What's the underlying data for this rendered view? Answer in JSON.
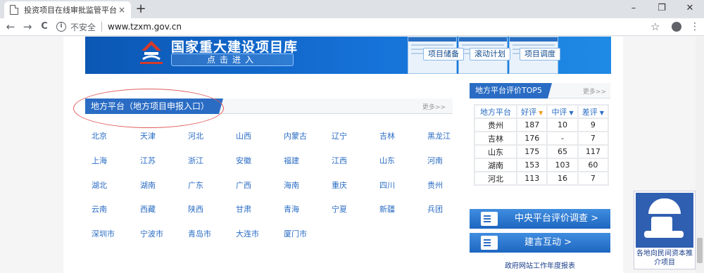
{
  "browser": {
    "tab_title": "投资项目在线审批监管平台",
    "tab_close": "×",
    "new_tab": "+",
    "window_controls": [
      "–",
      "❐",
      "✕"
    ],
    "nav": [
      "←",
      "→",
      "C"
    ],
    "security_label": "不安全",
    "url": "www.tzxm.gov.cn",
    "bookmark_star": "☆",
    "menu": "⋮"
  },
  "banner": {
    "title": "国家重大建设项目库",
    "enter_button": "点击进入",
    "tiles": [
      "项目储备",
      "滚动计划",
      "项目调度"
    ]
  },
  "local_platform": {
    "header": "地方平台（地方项目申报入口）",
    "more": "更多>>",
    "regions": [
      [
        "北京",
        "天津",
        "河北",
        "山西",
        "内蒙古",
        "辽宁",
        "吉林",
        "黑龙江"
      ],
      [
        "上海",
        "江苏",
        "浙江",
        "安徽",
        "福建",
        "江西",
        "山东",
        "河南"
      ],
      [
        "湖北",
        "湖南",
        "广东",
        "广西",
        "海南",
        "重庆",
        "四川",
        "贵州"
      ],
      [
        "云南",
        "西藏",
        "陕西",
        "甘肃",
        "青海",
        "宁夏",
        "新疆",
        "兵团"
      ],
      [
        "深圳市",
        "宁波市",
        "青岛市",
        "大连市",
        "厦门市"
      ]
    ]
  },
  "ranking": {
    "header": "地方平台评价TOP5",
    "more": "更多>>",
    "columns": [
      "地方平台",
      "好评",
      "中评",
      "差评"
    ],
    "rows": [
      [
        "贵州",
        "187",
        "10",
        "9"
      ],
      [
        "吉林",
        "176",
        "-",
        "7"
      ],
      [
        "山东",
        "175",
        "65",
        "117"
      ],
      [
        "湖南",
        "153",
        "103",
        "60"
      ],
      [
        "河北",
        "113",
        "16",
        "7"
      ]
    ]
  },
  "side_buttons": {
    "survey": "中央平台评价调查 >",
    "advice": "建言互动 >",
    "report_link": "政府网站工作年度报表"
  },
  "float_widget": {
    "caption": "各地向民间资本推介项目"
  },
  "colors": {
    "accent": "#2a6cc4",
    "banner": "#1672d8",
    "highlight_ellipse": "#e05a5a"
  }
}
